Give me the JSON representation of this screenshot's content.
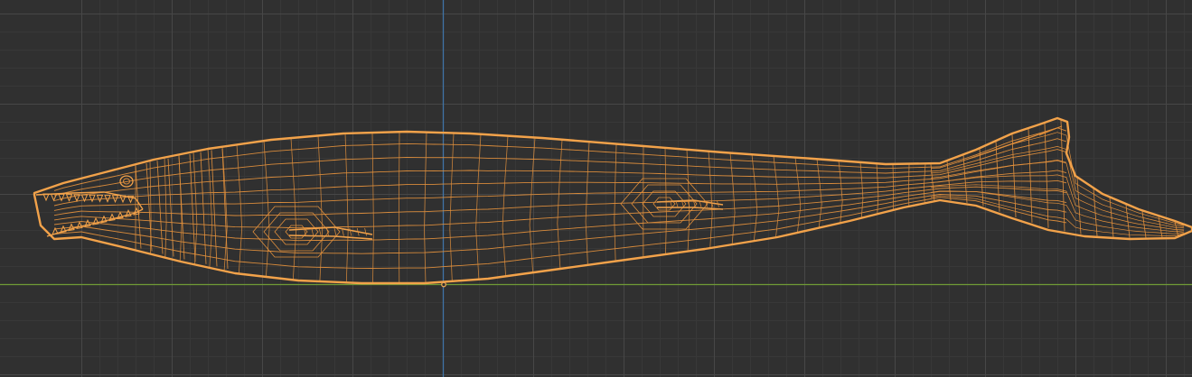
{
  "viewport": {
    "view": "orthographic-side",
    "shading": "wireframe",
    "selection_state": "object-selected"
  },
  "colors": {
    "background": "#303030",
    "grid_minor": "#383838",
    "grid_major": "#474747",
    "x_axis": "#6f9a36",
    "z_axis": "#3f73a6",
    "selection_outline": "#f2a24a",
    "wire": "#e08f3c",
    "origin_point": "#e9a552"
  },
  "object": {
    "name_icon": "mosasaur-wireframe-mesh",
    "parts": [
      "body",
      "head",
      "jaw-teeth",
      "front-flipper",
      "rear-flipper",
      "tail-fluke",
      "eye"
    ]
  }
}
